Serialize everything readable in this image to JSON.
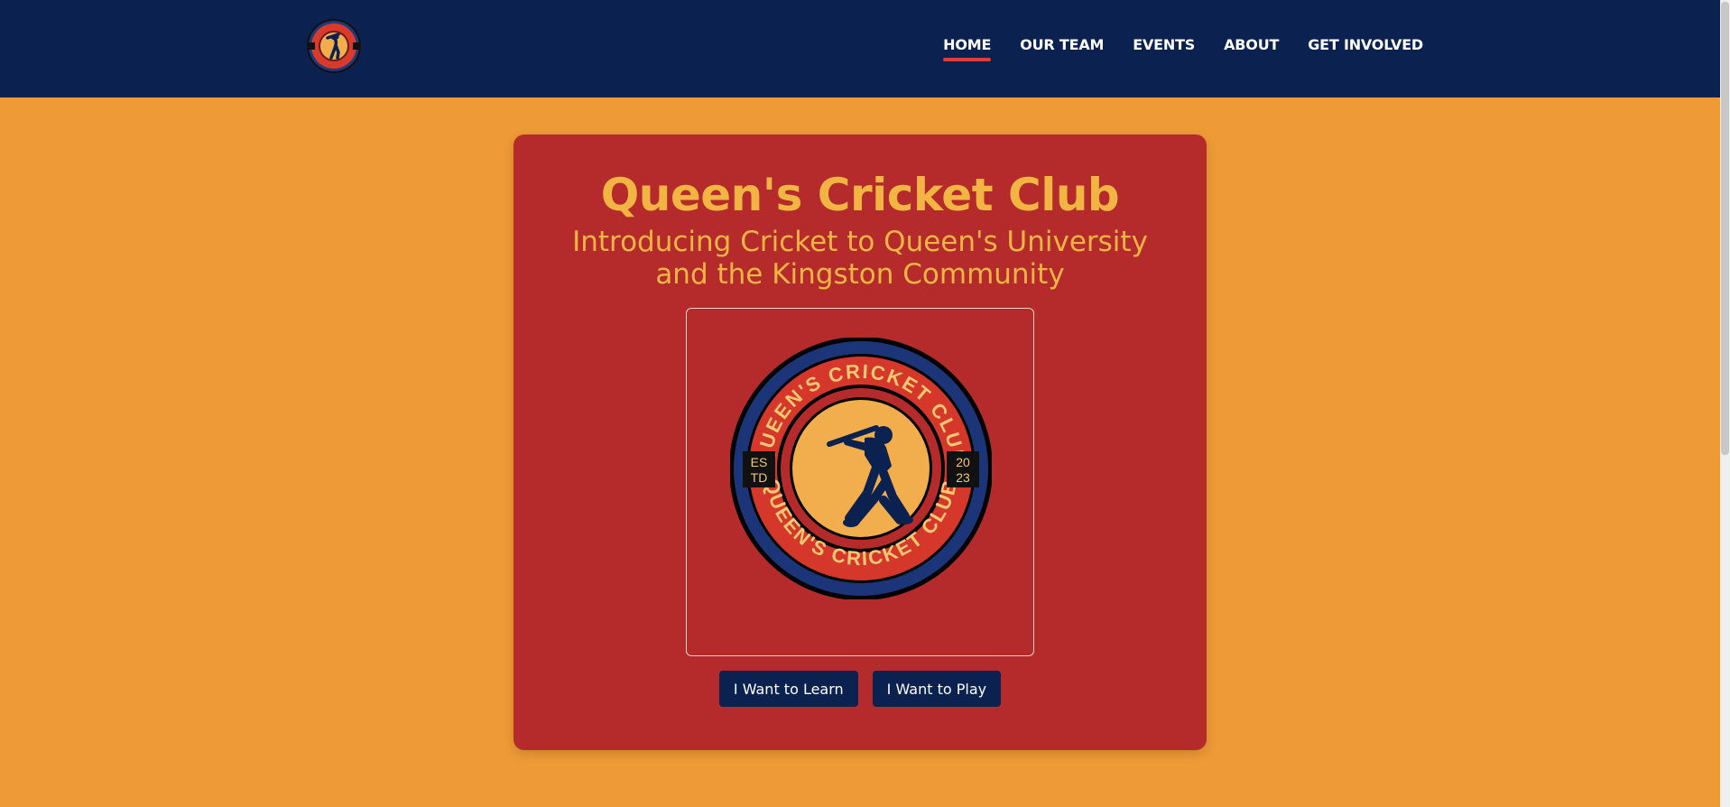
{
  "nav": {
    "items": [
      {
        "label": "HOME",
        "active": true
      },
      {
        "label": "OUR TEAM",
        "active": false
      },
      {
        "label": "EVENTS",
        "active": false
      },
      {
        "label": "ABOUT",
        "active": false
      },
      {
        "label": "GET INVOLVED",
        "active": false
      }
    ]
  },
  "hero": {
    "title": "Queen's Cricket Club",
    "subtitle": "Introducing Cricket to Queen's University and the Kingston Community",
    "buttons": {
      "learn": "I Want to Learn",
      "play": "I Want to Play"
    }
  },
  "logo": {
    "ring_text": "QUEEN'S CRICKET CLUB",
    "left_badge": [
      "ES",
      "TD"
    ],
    "right_badge": [
      "20",
      "23"
    ]
  },
  "colors": {
    "navy": "#0b2250",
    "orange_bg": "#ee9a36",
    "card_red": "#b52b2b",
    "gold_text": "#f2b544",
    "active_underline": "#e03c3a"
  }
}
